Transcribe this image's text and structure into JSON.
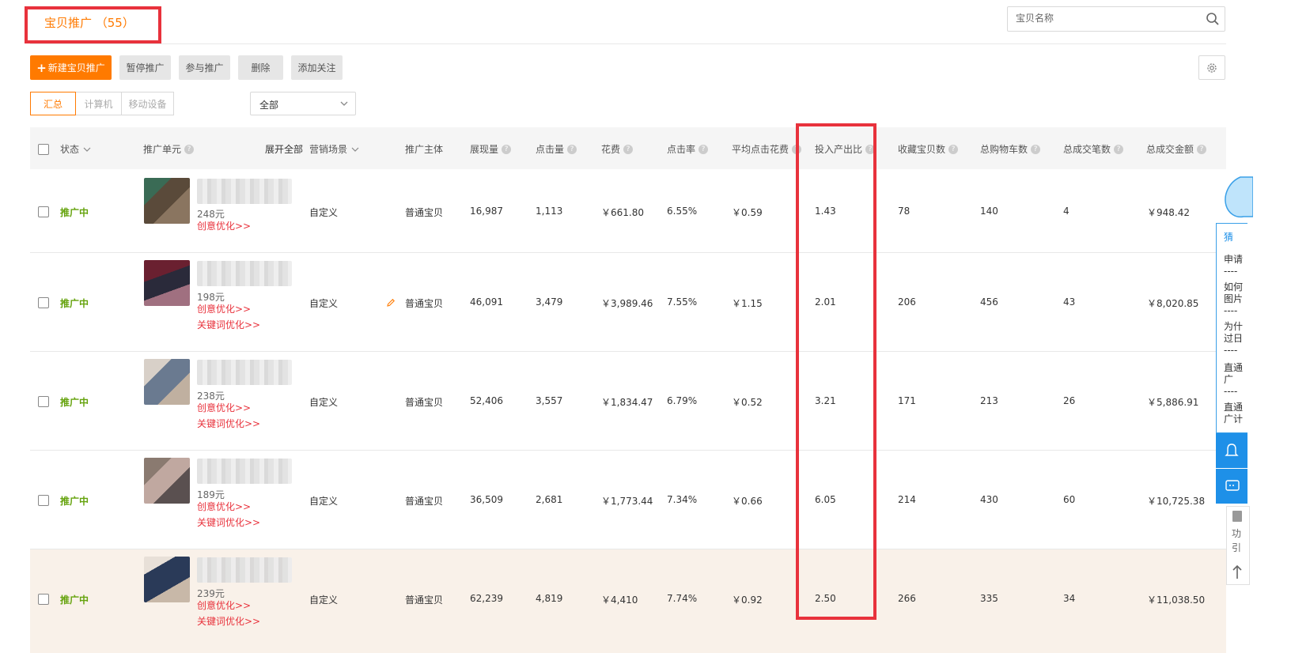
{
  "header": {
    "title": "宝贝推广 （55）",
    "search_placeholder": "宝贝名称"
  },
  "toolbar": {
    "new_label": "新建宝贝推广",
    "pause_label": "暂停推广",
    "join_label": "参与推广",
    "delete_label": "删除",
    "follow_label": "添加关注"
  },
  "device_tabs": [
    "汇总",
    "计算机",
    "移动设备"
  ],
  "filter": {
    "selected": "全部"
  },
  "table": {
    "headers": {
      "status": "状态",
      "unit": "推广单元",
      "expand_all": "展开全部",
      "scene": "营销场景",
      "subject": "推广主体",
      "impressions": "展现量",
      "clicks": "点击量",
      "cost": "花费",
      "ctr": "点击率",
      "cpc": "平均点击花费",
      "roi": "投入产出比",
      "favorites": "收藏宝贝数",
      "cart": "总购物车数",
      "orders": "总成交笔数",
      "gmv": "总成交金额"
    },
    "creative_link": "创意优化>>",
    "keyword_link": "关键词优化>>",
    "rows": [
      {
        "status": "推广中",
        "price": "248元",
        "scene": "自定义",
        "subject": "普通宝贝",
        "impressions": "16,987",
        "clicks": "1,113",
        "cost": "￥661.80",
        "ctr": "6.55%",
        "cpc": "￥0.59",
        "roi": "1.43",
        "favorites": "78",
        "cart": "140",
        "orders": "4",
        "gmv": "￥948.42"
      },
      {
        "status": "推广中",
        "price": "198元",
        "scene": "自定义",
        "subject": "普通宝贝",
        "impressions": "46,091",
        "clicks": "3,479",
        "cost": "￥3,989.46",
        "ctr": "7.55%",
        "cpc": "￥1.15",
        "roi": "2.01",
        "favorites": "206",
        "cart": "456",
        "orders": "43",
        "gmv": "￥8,020.85"
      },
      {
        "status": "推广中",
        "price": "238元",
        "scene": "自定义",
        "subject": "普通宝贝",
        "impressions": "52,406",
        "clicks": "3,557",
        "cost": "￥1,834.47",
        "ctr": "6.79%",
        "cpc": "￥0.52",
        "roi": "3.21",
        "favorites": "171",
        "cart": "213",
        "orders": "26",
        "gmv": "￥5,886.91"
      },
      {
        "status": "推广中",
        "price": "189元",
        "scene": "自定义",
        "subject": "普通宝贝",
        "impressions": "36,509",
        "clicks": "2,681",
        "cost": "￥1,773.44",
        "ctr": "7.34%",
        "cpc": "￥0.66",
        "roi": "6.05",
        "favorites": "214",
        "cart": "430",
        "orders": "60",
        "gmv": "￥10,725.38"
      },
      {
        "status": "推广中",
        "price": "239元",
        "scene": "自定义",
        "subject": "普通宝贝",
        "impressions": "62,239",
        "clicks": "4,819",
        "cost": "￥4,410",
        "ctr": "7.74%",
        "cpc": "￥0.92",
        "roi": "2.50",
        "favorites": "266",
        "cart": "335",
        "orders": "34",
        "gmv": "￥11,038.50"
      }
    ]
  },
  "side_panel": {
    "items": [
      "猜",
      "申请\n----",
      "如何\n图片\n----",
      "为什\n过日\n----",
      "直通\n广\n----",
      "直通\n广计"
    ],
    "gray_lines": [
      "功",
      "引"
    ]
  },
  "colors": {
    "accent": "#ff7a00",
    "highlight_border": "#e8323c",
    "status_green": "#65a30d",
    "link_red": "#e8323c",
    "panel_blue": "#1e90e8"
  }
}
